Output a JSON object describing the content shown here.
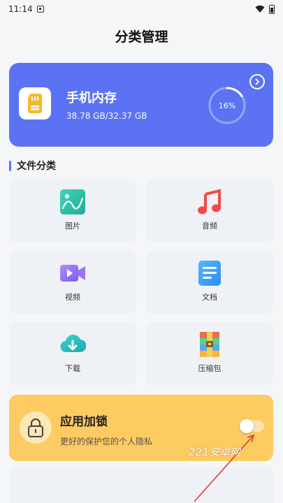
{
  "status_bar": {
    "time": "11:14"
  },
  "header": {
    "title": "分类管理"
  },
  "storage": {
    "title": "手机内存",
    "usage": "38.78 GB/32.37 GB",
    "percent_label": "16%",
    "percent_value": 16,
    "accent_color": "#5b73f2"
  },
  "categories": {
    "section_title": "文件分类",
    "items": [
      {
        "label": "图片",
        "icon": "image-icon"
      },
      {
        "label": "音频",
        "icon": "music-icon"
      },
      {
        "label": "视频",
        "icon": "video-icon"
      },
      {
        "label": "文档",
        "icon": "document-icon"
      },
      {
        "label": "下载",
        "icon": "download-icon"
      },
      {
        "label": "压缩包",
        "icon": "archive-icon"
      }
    ]
  },
  "app_lock": {
    "title": "应用加锁",
    "subtitle": "更好的保护您的个人隐私",
    "enabled": false,
    "card_color": "#fdcb62"
  },
  "watermark": {
    "text": "221安卓网"
  }
}
